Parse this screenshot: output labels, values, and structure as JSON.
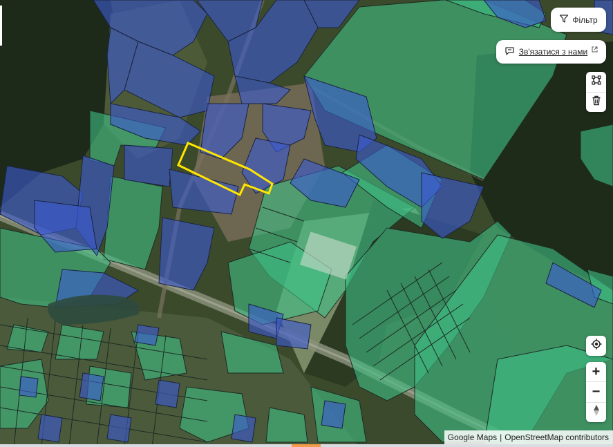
{
  "map": {
    "provider": "Google Maps",
    "attribution": {
      "google": "Google Maps",
      "separator": "|",
      "osm": "OpenStreetMap contributors"
    },
    "selected_parcel_color": "#ffe600",
    "parcel_blue": "#3b5bd0",
    "parcel_green": "#3fbf86"
  },
  "controls": {
    "filter_label": "Фільтр",
    "contact_label": "Зв'язатися з нами",
    "icons": {
      "filter": "funnel-icon",
      "contact": "chat-bubble-icon",
      "external": "external-link-icon",
      "draw": "polygon-draw-icon",
      "delete": "trash-icon",
      "locate": "locate-target-icon",
      "zoom_in": "plus-icon",
      "zoom_out": "minus-icon",
      "compass": "compass-north-icon"
    },
    "zoom_in_label": "+",
    "zoom_out_label": "−"
  }
}
